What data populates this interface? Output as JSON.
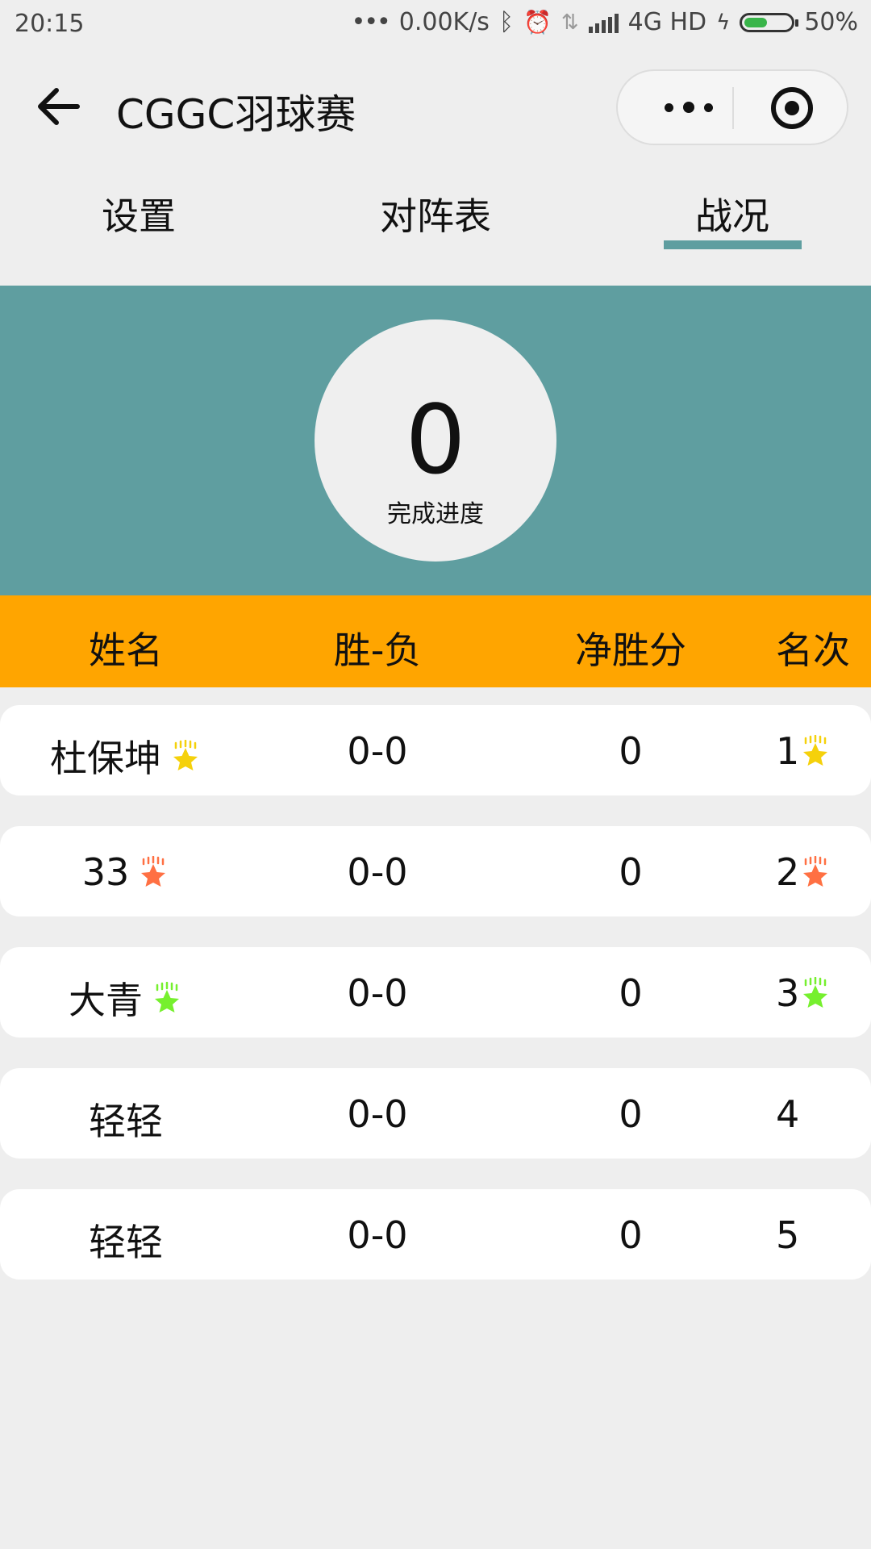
{
  "status_bar": {
    "time": "20:15",
    "speed": "0.00K/s",
    "network": "4G HD",
    "battery_level": 0.5,
    "battery_text": "50%",
    "battery_color": "#39b54a"
  },
  "nav": {
    "title": "CGGC羽球赛",
    "back_icon": "arrow-left-icon",
    "more_icon": "more-dots-icon",
    "close_icon": "target-icon"
  },
  "tabs": [
    {
      "label": "设置",
      "active": false
    },
    {
      "label": "对阵表",
      "active": false
    },
    {
      "label": "战况",
      "active": true
    }
  ],
  "progress": {
    "value": "0",
    "label": "完成进度",
    "accent": "#5f9ea0"
  },
  "table": {
    "header_color": "#ffa500",
    "headers": {
      "name": "姓名",
      "record": "胜-负",
      "net": "净胜分",
      "rank": "名次"
    },
    "rows": [
      {
        "name": "杜保坤",
        "record": "0-0",
        "net": "0",
        "rank": "1",
        "badge_color": "#f5d10b"
      },
      {
        "name": "33",
        "record": "0-0",
        "net": "0",
        "rank": "2",
        "badge_color": "#ff7043"
      },
      {
        "name": "大青",
        "record": "0-0",
        "net": "0",
        "rank": "3",
        "badge_color": "#76f02e"
      },
      {
        "name": "轻轻",
        "record": "0-0",
        "net": "0",
        "rank": "4",
        "badge_color": null
      },
      {
        "name": "轻轻",
        "record": "0-0",
        "net": "0",
        "rank": "5",
        "badge_color": null
      }
    ]
  }
}
